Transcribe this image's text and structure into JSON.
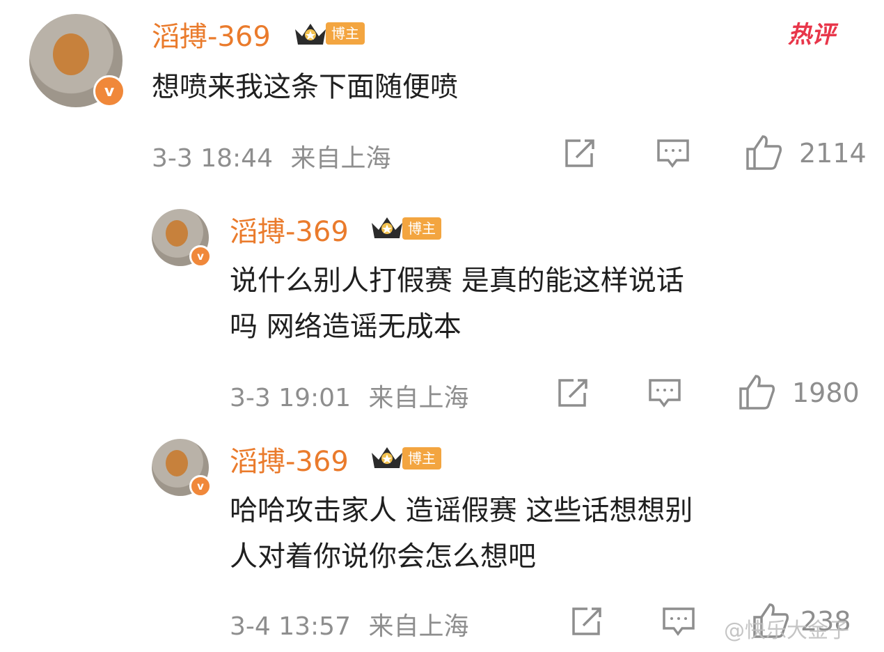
{
  "hot_tag": "热评",
  "watermark": "@快乐大金子",
  "colors": {
    "username": "#ea7b2c",
    "badge": "#f3a540",
    "meta": "#8e8e8e",
    "hot": "#e8364a"
  },
  "comments": [
    {
      "username": "滔搏-369",
      "role": "博主",
      "lines": [
        "想喷来我这条下面随便喷"
      ],
      "time": "3-3 18:44",
      "location": "来自上海",
      "likes": "2114",
      "icons": [
        "share-icon",
        "reply-icon",
        "like-icon"
      ]
    },
    {
      "username": "滔搏-369",
      "role": "博主",
      "lines": [
        "说什么别人打假赛 是真的能这样说话",
        "吗 网络造谣无成本"
      ],
      "time": "3-3 19:01",
      "location": "来自上海",
      "likes": "1980",
      "icons": [
        "share-icon",
        "reply-icon",
        "like-icon"
      ]
    },
    {
      "username": "滔搏-369",
      "role": "博主",
      "lines": [
        "哈哈攻击家人 造谣假赛 这些话想想别",
        "人对着你说你会怎么想吧"
      ],
      "time": "3-4 13:57",
      "location": "来自上海",
      "likes": "238",
      "icons": [
        "share-icon",
        "reply-icon",
        "like-icon"
      ]
    }
  ]
}
